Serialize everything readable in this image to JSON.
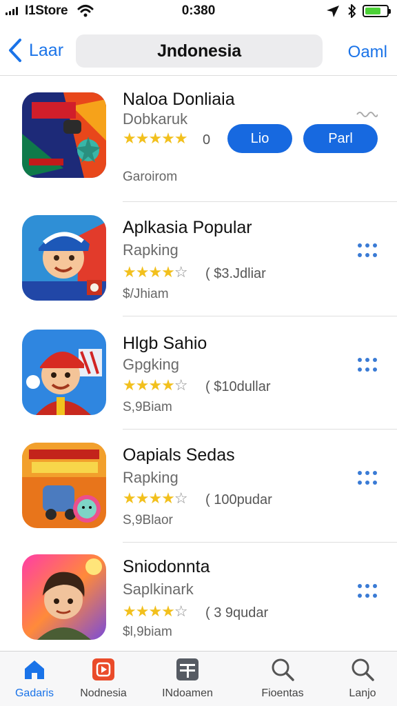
{
  "status_bar": {
    "carrier": "I1Store",
    "time": "0:380"
  },
  "nav": {
    "back_label": "Laar",
    "title": "Jndonesia",
    "right_label": "Oaml"
  },
  "apps": [
    {
      "name": "Naloa Donliaia",
      "subtitle": "Dobkaruk",
      "rating": 5,
      "rating_count": "0",
      "size": "Garoirom",
      "buttons": [
        "Lio",
        "Parl"
      ],
      "icon": "game-poster-icon"
    },
    {
      "name": "Aplkasia Popular",
      "subtitle": "Rapking",
      "rating": 4.5,
      "price": "( $3.Jdliar",
      "size": "$/Jhiam",
      "icon": "cartoon-boy-cap-icon"
    },
    {
      "name": "Hlgb Sahio",
      "subtitle": "Gpgking",
      "rating": 4.5,
      "price": "( $10dullar",
      "size": "S,9Biam",
      "icon": "cartoon-boy-red-cap-icon"
    },
    {
      "name": "Oapials Sedas",
      "subtitle": "Rapking",
      "rating": 4.5,
      "price": "( 100pudar",
      "size": "S,9Blaor",
      "icon": "cartoon-game-icon"
    },
    {
      "name": "Sniodonnta",
      "subtitle": "Saplkinark",
      "rating": 4.5,
      "price": "( 3 9qudar",
      "size": "$l,9biam",
      "icon": "cartoon-boy-portrait-icon"
    }
  ],
  "tabs": [
    {
      "label": "Gadaris",
      "icon": "home-icon",
      "active": true
    },
    {
      "label": "Nodnesia",
      "icon": "play-square-icon",
      "active": false
    },
    {
      "label": "INdoamen",
      "icon": "grid-icon",
      "active": false
    },
    {
      "label": "Fioentas",
      "icon": "search-icon",
      "active": false
    },
    {
      "label": "Lanjo",
      "icon": "search-icon",
      "active": false
    }
  ],
  "colors": {
    "accent": "#1a73e8",
    "star": "#f2c01d",
    "button": "#1769e0",
    "battery": "#4cd137"
  }
}
